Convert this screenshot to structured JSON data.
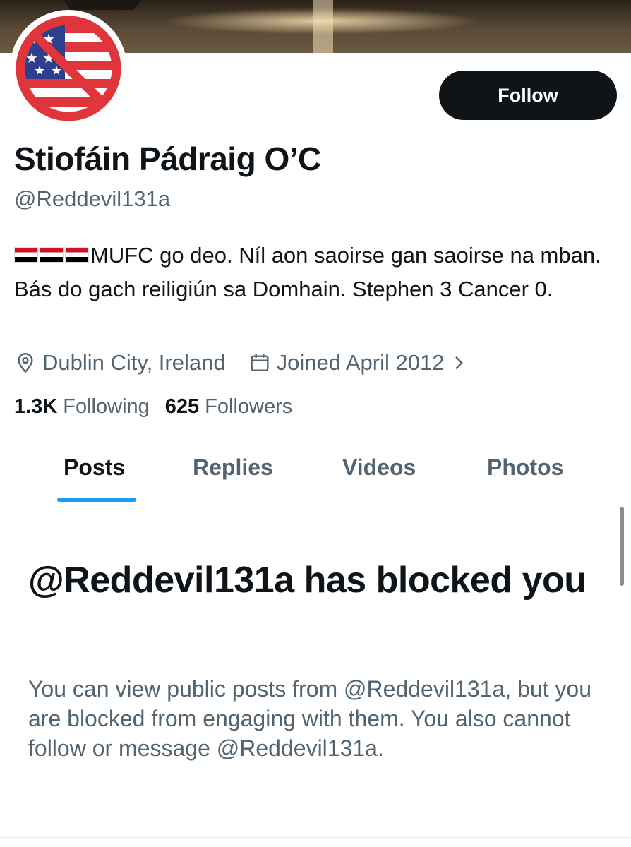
{
  "profile": {
    "name": "Stiofáin Pádraig O’C",
    "handle": "@Reddevil131a",
    "bio_flags": [
      "egypt-flag-icon",
      "egypt-flag-icon",
      "egypt-flag-icon"
    ],
    "bio": "MUFC go deo. Níl aon saoirse gan saoirse na mban. Bás do gach reiligiún sa Domhain. Stephen 3 Cancer 0.",
    "location": "Dublin City, Ireland",
    "joined": "Joined April 2012",
    "following_count": "1.3K",
    "following_label": "Following",
    "followers_count": "625",
    "followers_label": "Followers"
  },
  "actions": {
    "follow_label": "Follow"
  },
  "tabs": [
    {
      "label": "Posts",
      "active": true
    },
    {
      "label": "Replies",
      "active": false
    },
    {
      "label": "Videos",
      "active": false
    },
    {
      "label": "Photos",
      "active": false
    }
  ],
  "blocked": {
    "title": "@Reddevil131a has blocked you",
    "description": "You can view public posts from @Reddevil131a, but you are blocked from engaging with them. You also cannot follow or message @Reddevil131a."
  },
  "colors": {
    "text_primary": "#0f1419",
    "text_secondary": "#536471",
    "accent": "#1d9bf0",
    "button": "#0f1419"
  },
  "icons": {
    "location": "location-pin-icon",
    "calendar": "calendar-icon",
    "chevron": "chevron-right-icon"
  }
}
